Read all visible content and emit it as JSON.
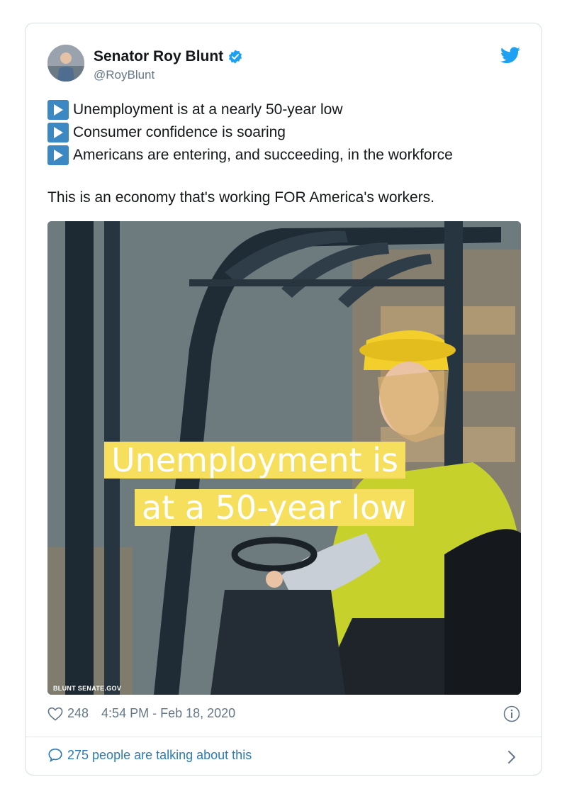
{
  "tweet": {
    "display_name": "Senator Roy Blunt",
    "handle": "@RoyBlunt",
    "bullets": [
      "Unemployment is at a nearly 50-year low",
      "Consumer confidence is soaring",
      "Americans are entering, and succeeding, in the workforce"
    ],
    "statement": "This is an economy that's working FOR America's workers.",
    "media": {
      "caption_line_1": "Unemployment is",
      "caption_line_2": "at a 50-year low",
      "watermark": "BLUNT SENATE.GOV"
    },
    "likes": "248",
    "timestamp": "4:54 PM - Feb 18, 2020",
    "talking": "275 people are talking about this"
  },
  "icons": {
    "verified": "verified-badge-icon",
    "brand": "twitter-bird-icon",
    "bullet": "play-button-icon",
    "like": "heart-icon",
    "info": "info-icon",
    "reply": "speech-bubble-icon",
    "chevron": "chevron-right-icon"
  },
  "colors": {
    "brand": "#1da1f2",
    "link": "#2b7bb9",
    "bullet": "#3b88c3",
    "caption_highlight": "#f6df5c"
  }
}
